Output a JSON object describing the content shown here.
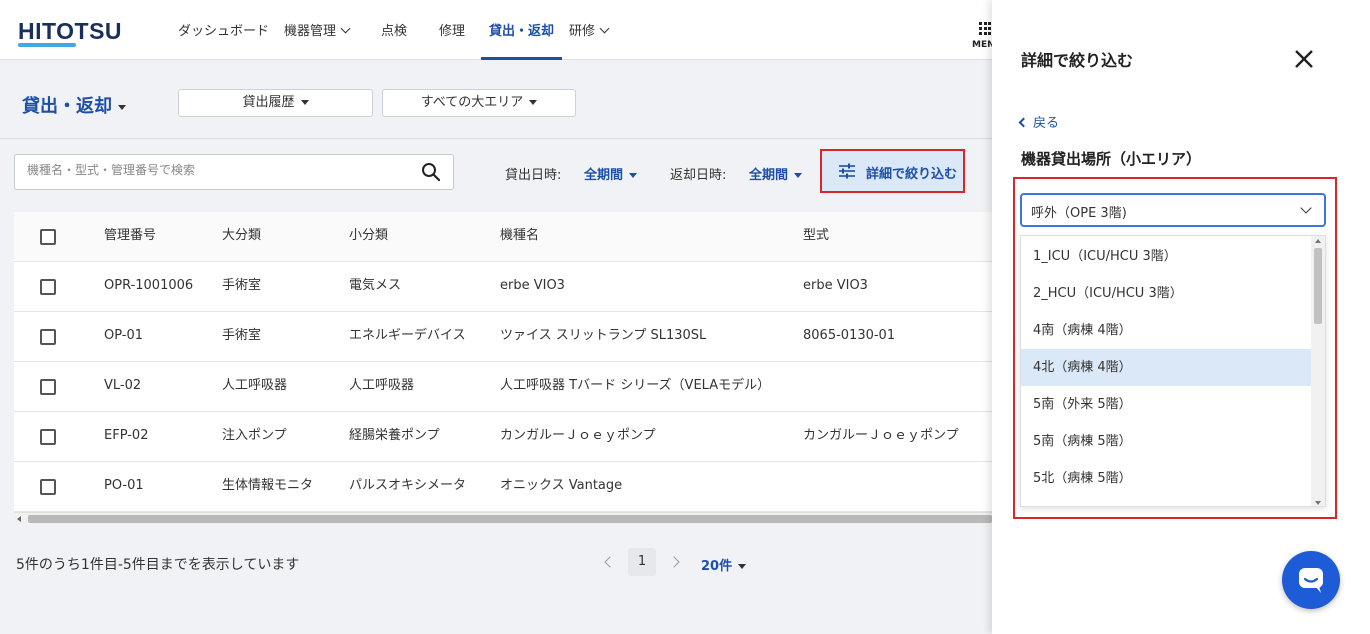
{
  "header": {
    "logo": "HITOTSU",
    "nav": [
      "ダッシュボード",
      "機器管理",
      "点検",
      "修理",
      "貸出・返却",
      "研修"
    ],
    "menu_label": "MENU"
  },
  "page": {
    "title": "貸出・返却",
    "history_select": "貸出履歴",
    "area_select": "すべての大エリア"
  },
  "filters": {
    "search_placeholder": "機種名・型式・管理番号で検索",
    "lend_label": "貸出日時:",
    "lend_value": "全期間",
    "return_label": "返却日時:",
    "return_value": "全期間",
    "detail_button": "詳細で絞り込む"
  },
  "table": {
    "columns": [
      "管理番号",
      "大分類",
      "小分類",
      "機種名",
      "型式"
    ],
    "rows": [
      [
        "OPR-1001006",
        "手術室",
        "電気メス",
        "erbe VIO3",
        "erbe VIO3"
      ],
      [
        "OP-01",
        "手術室",
        "エネルギーデバイス",
        "ツァイス スリットランプ SL130SL",
        "8065-0130-01"
      ],
      [
        "VL-02",
        "人工呼吸器",
        "人工呼吸器",
        "人工呼吸器 Tバード シリーズ（VELAモデル）",
        ""
      ],
      [
        "EFP-02",
        "注入ポンプ",
        "経腸栄養ポンプ",
        "カンガルーＪｏｅｙポンプ",
        "カンガルーＪｏｅｙポンプ"
      ],
      [
        "PO-01",
        "生体情報モニタ",
        "パルスオキシメータ",
        "オニックス Vantage",
        ""
      ]
    ]
  },
  "footer": {
    "summary": "5件のうち1件目-5件目までを表示しています",
    "current_page": "1",
    "page_size": "20件"
  },
  "panel": {
    "title": "詳細で絞り込む",
    "back": "戻る",
    "section": "機器貸出場所（小エリア）",
    "selected": "呼外（OPE 3階)",
    "options": [
      "1_ICU（ICU/HCU 3階）",
      "2_HCU（ICU/HCU 3階）",
      "4南（病棟 4階）",
      "4北（病棟 4階）",
      "5南（外来 5階）",
      "5南（病棟 5階）",
      "5北（病棟 5階）"
    ],
    "hover_index": 3
  },
  "colors": {
    "accent": "#1e4fa8",
    "highlight_border": "#d92626",
    "chat": "#1e5bd6"
  }
}
